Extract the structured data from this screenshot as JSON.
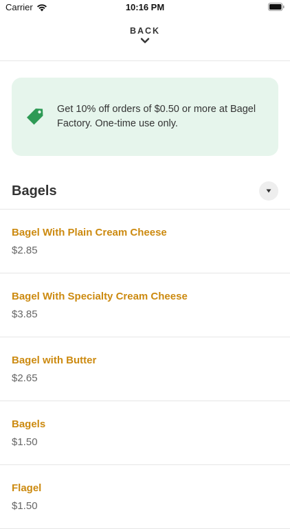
{
  "status_bar": {
    "carrier": "Carrier",
    "time": "10:16 PM"
  },
  "nav": {
    "back_label": "BACK"
  },
  "promo": {
    "text": "Get 10% off orders of $0.50 or more at Bagel Factory. One-time use only.",
    "background": "#e6f5ec",
    "icon": "price-tag-icon",
    "icon_color": "#2e9a55"
  },
  "section": {
    "title": "Bagels",
    "toggle_icon": "caret-down-icon"
  },
  "menu_items": [
    {
      "name": "Bagel With Plain Cream Cheese",
      "price": "$2.85"
    },
    {
      "name": "Bagel With Specialty Cream Cheese",
      "price": "$3.85"
    },
    {
      "name": "Bagel with Butter",
      "price": "$2.65"
    },
    {
      "name": "Bagels",
      "price": "$1.50"
    },
    {
      "name": "Flagel",
      "price": "$1.50"
    }
  ],
  "colors": {
    "item_name": "#cc8a10",
    "item_price": "#666666",
    "divider": "#e6e6e6"
  }
}
